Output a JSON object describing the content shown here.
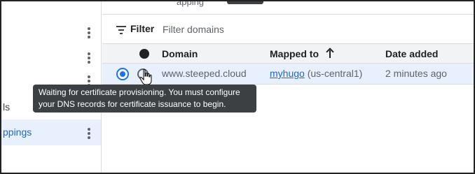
{
  "top_strip": {
    "partial_text": "apping",
    "chip_color": "#3c4043"
  },
  "sidebar": {
    "items": [
      {
        "label": "",
        "icon": "more-vert-icon"
      },
      {
        "label": "",
        "icon": "more-vert-icon"
      },
      {
        "label": "",
        "icon": "more-vert-icon"
      },
      {
        "label": "ls",
        "icon": ""
      },
      {
        "label": "ppings",
        "icon": "more-vert-icon",
        "active": true
      }
    ],
    "active_color": "#1967d2"
  },
  "filter": {
    "icon": "filter-list-icon",
    "label": "Filter",
    "placeholder": "Filter domains",
    "value": ""
  },
  "table": {
    "columns": {
      "status_icon": "status-dot-icon",
      "domain": "Domain",
      "mapped_to": "Mapped to",
      "sort_icon": "arrow-upward-icon",
      "date_added": "Date added"
    },
    "rows": [
      {
        "selected": true,
        "status_icon": "pending-status-icon",
        "domain": "www.steeped.cloud",
        "mapped_service": "myhugo",
        "mapped_region": "(us-central1)",
        "date_added": "2 minutes ago"
      }
    ]
  },
  "tooltip": {
    "line1": "Waiting for certificate provisioning. You must configure",
    "line2": "your DNS records for certificate issuance to begin."
  },
  "colors": {
    "accent": "#1a73e8",
    "selected_row": "#e8f0fe",
    "header_bg": "#f1f3f4",
    "tooltip_bg": "#3c4043"
  }
}
